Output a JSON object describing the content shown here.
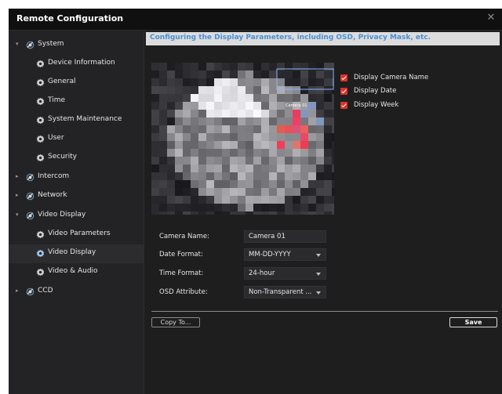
{
  "window": {
    "title": "Remote Configuration",
    "close_icon": "close-icon"
  },
  "sidebar": {
    "items": [
      {
        "label": "System",
        "level": 0,
        "expanded": true
      },
      {
        "label": "Device Information",
        "level": 1
      },
      {
        "label": "General",
        "level": 1
      },
      {
        "label": "Time",
        "level": 1
      },
      {
        "label": "System Maintenance",
        "level": 1
      },
      {
        "label": "User",
        "level": 1
      },
      {
        "label": "Security",
        "level": 1
      },
      {
        "label": "Intercom",
        "level": 0,
        "expanded": false
      },
      {
        "label": "Network",
        "level": 0,
        "expanded": false
      },
      {
        "label": "Video Display",
        "level": 0,
        "expanded": true
      },
      {
        "label": "Video Parameters",
        "level": 1
      },
      {
        "label": "Video Display",
        "level": 1,
        "selected": true
      },
      {
        "label": "Video & Audio",
        "level": 1
      },
      {
        "label": "CCD",
        "level": 0,
        "expanded": false
      }
    ]
  },
  "main": {
    "banner": "Configuring the Display Parameters, including OSD, Privacy Mask, etc.",
    "preview_osd": {
      "camera_name": "Camera 01"
    },
    "checkboxes": [
      {
        "label": "Display Camera Name",
        "checked": true
      },
      {
        "label": "Display Date",
        "checked": true
      },
      {
        "label": "Display Week",
        "checked": true
      }
    ],
    "form": {
      "camera_name": {
        "label": "Camera Name:",
        "value": "Camera 01"
      },
      "date_format": {
        "label": "Date Format:",
        "value": "MM-DD-YYYY"
      },
      "time_format": {
        "label": "Time Format:",
        "value": "24-hour"
      },
      "osd_attribute": {
        "label": "OSD Attribute:",
        "value": "Non-Transparent ..."
      }
    },
    "buttons": {
      "copy_to": "Copy To...",
      "save": "Save"
    }
  },
  "colors": {
    "accent": "#4a8fd6",
    "checkbox": "#d9342b",
    "background": "#1e1e1f"
  }
}
